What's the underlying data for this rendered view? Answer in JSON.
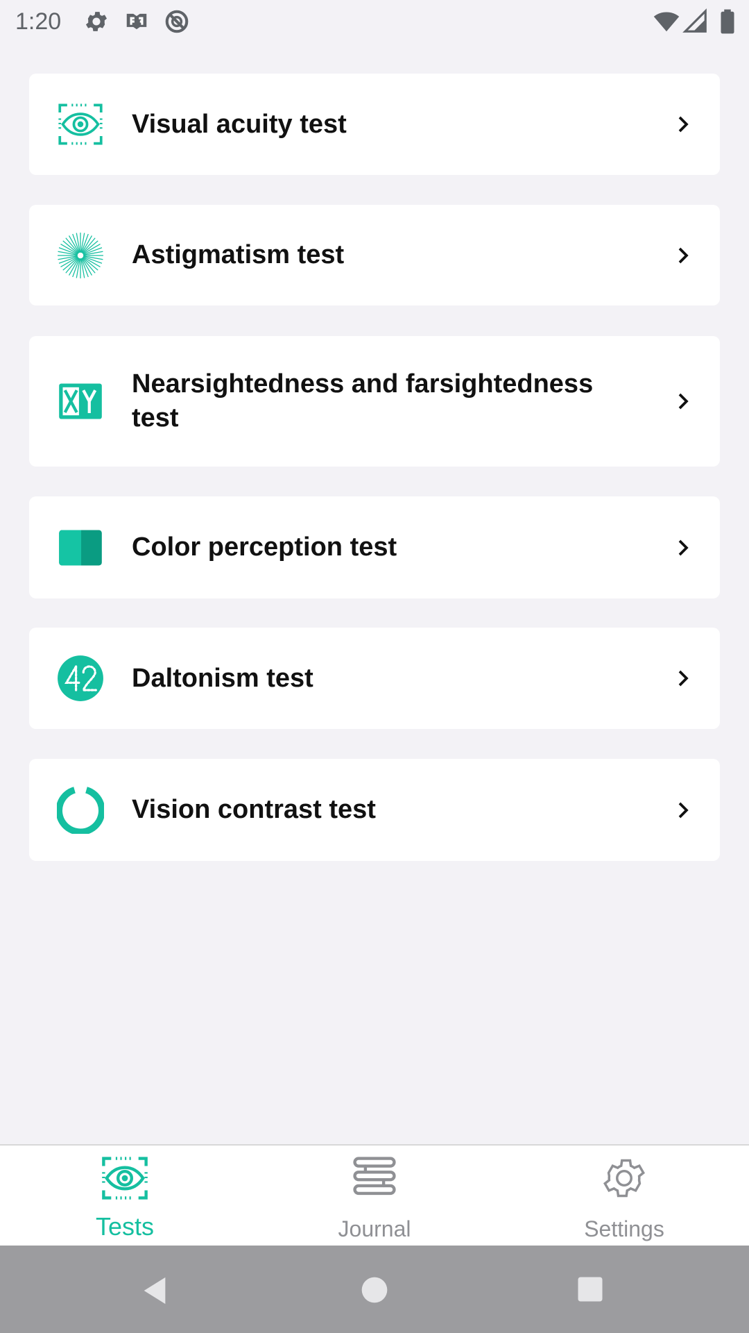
{
  "status_bar": {
    "time": "1:20",
    "left_icons": [
      "gear-icon",
      "shop-icon",
      "no-sync-icon"
    ],
    "right_icons": [
      "wifi-icon",
      "signal-icon",
      "battery-icon"
    ]
  },
  "tests": [
    {
      "label": "Visual acuity test",
      "icon": "eye-scan-icon"
    },
    {
      "label": "Astigmatism test",
      "icon": "starburst-icon"
    },
    {
      "label": "Nearsightedness and farsightedness test",
      "icon": "xy-icon"
    },
    {
      "label": "Color perception test",
      "icon": "color-split-icon"
    },
    {
      "label": "Daltonism test",
      "icon": "number-42-icon"
    },
    {
      "label": "Vision contrast test",
      "icon": "ring-icon"
    }
  ],
  "bottom_nav": {
    "items": [
      {
        "label": "Tests",
        "icon": "eye-scan-icon",
        "active": true
      },
      {
        "label": "Journal",
        "icon": "journal-icon",
        "active": false
      },
      {
        "label": "Settings",
        "icon": "gear-icon",
        "active": false
      }
    ]
  },
  "colors": {
    "accent": "#15bfa0",
    "accent_dark": "#0a9c82",
    "inactive": "#8f9094",
    "background": "#f3f2f6"
  },
  "system_nav": [
    "back-icon",
    "home-icon",
    "recents-icon"
  ]
}
